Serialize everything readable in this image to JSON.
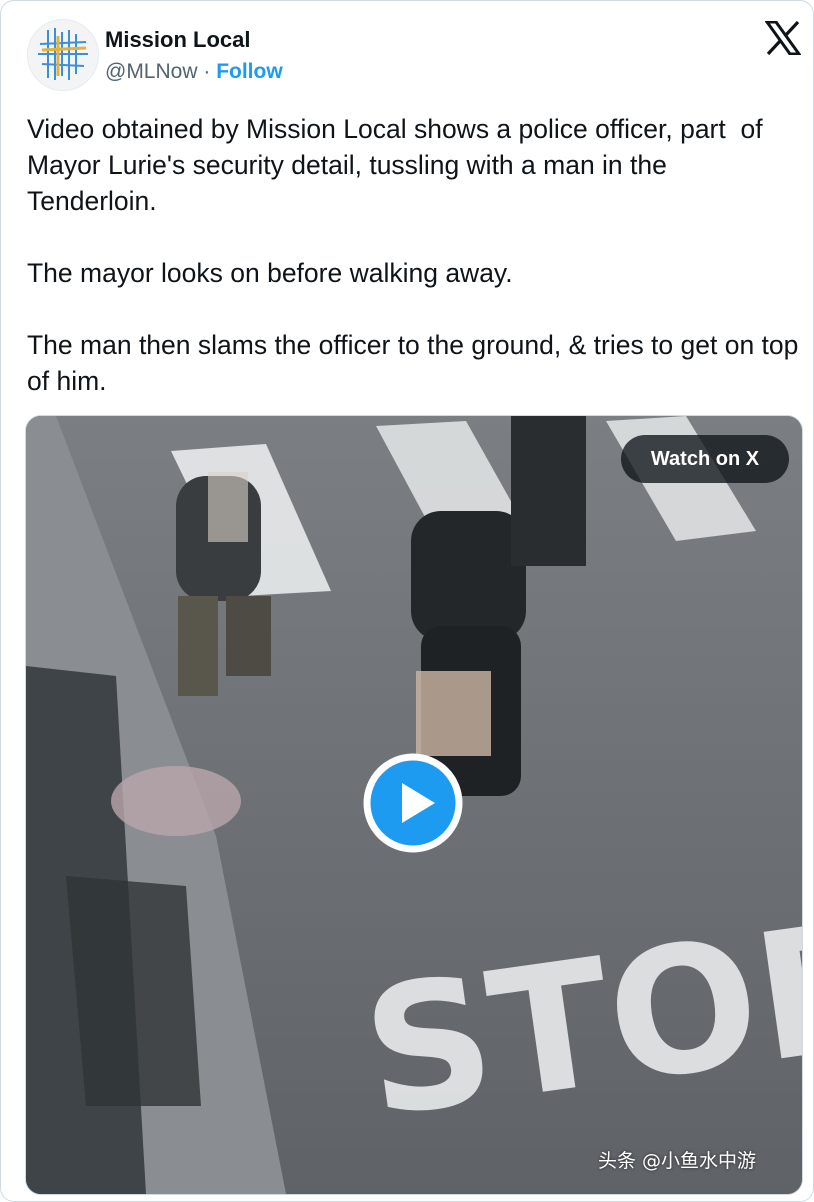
{
  "author": {
    "name": "Mission Local",
    "handle": "@MLNow",
    "separator": " · ",
    "follow_label": "Follow",
    "avatar_icon": "mission-local-logo"
  },
  "platform_icon": "x-logo-icon",
  "tweet": {
    "paragraphs": [
      "Video obtained by Mission Local shows a police officer, part  of Mayor Lurie's security detail, tussling with a man in the Tenderloin.",
      "The mayor looks on before walking away.",
      "The man then slams the officer to the ground, & tries to get on top of him."
    ]
  },
  "media": {
    "type": "video",
    "watch_label": "Watch on X",
    "play_icon": "play-icon",
    "road_text": "STOP"
  },
  "watermark": "头条 @小鱼水中游",
  "colors": {
    "accent": "#1d9bf0",
    "text": "#0f1419",
    "secondary": "#536471"
  }
}
